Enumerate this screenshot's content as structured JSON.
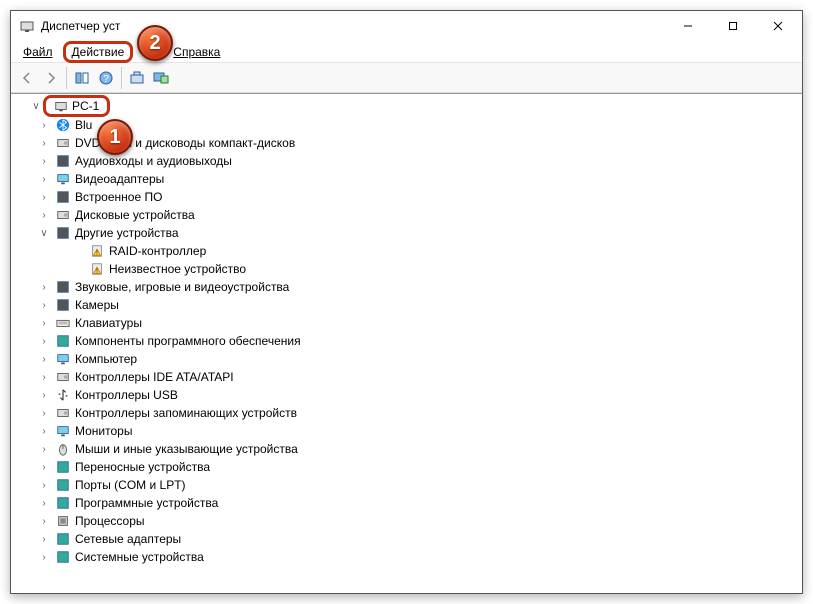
{
  "window": {
    "title": "Диспетчер уст"
  },
  "menu": {
    "file": "Файл",
    "action": "Действие",
    "help": "Справка"
  },
  "badges": {
    "step1": "1",
    "step2": "2"
  },
  "root": "PC-1",
  "categories": [
    {
      "icon": "bluetooth",
      "label": "Blu",
      "expandable": true
    },
    {
      "icon": "dvd",
      "label": "DVD                  воды и дисководы компакт-дисков",
      "expandable": true
    },
    {
      "icon": "audio",
      "label": "Аудиовходы и аудиовыходы",
      "expandable": true
    },
    {
      "icon": "display",
      "label": "Видеоадаптеры",
      "expandable": true
    },
    {
      "icon": "firmware",
      "label": "Встроенное ПО",
      "expandable": true
    },
    {
      "icon": "disk",
      "label": "Дисковые устройства",
      "expandable": true
    },
    {
      "icon": "other",
      "label": "Другие устройства",
      "expandable": true,
      "expanded": true,
      "children": [
        {
          "icon": "warn",
          "label": "RAID-контроллер"
        },
        {
          "icon": "warn",
          "label": "Неизвестное устройство"
        }
      ]
    },
    {
      "icon": "sound",
      "label": "Звуковые, игровые и видеоустройства",
      "expandable": true
    },
    {
      "icon": "camera",
      "label": "Камеры",
      "expandable": true
    },
    {
      "icon": "keyboard",
      "label": "Клавиатуры",
      "expandable": true
    },
    {
      "icon": "swcomp",
      "label": "Компоненты программного обеспечения",
      "expandable": true
    },
    {
      "icon": "computer",
      "label": "Компьютер",
      "expandable": true
    },
    {
      "icon": "ide",
      "label": "Контроллеры IDE ATA/ATAPI",
      "expandable": true
    },
    {
      "icon": "usb",
      "label": "Контроллеры USB",
      "expandable": true
    },
    {
      "icon": "storage",
      "label": "Контроллеры запоминающих устройств",
      "expandable": true
    },
    {
      "icon": "monitor",
      "label": "Мониторы",
      "expandable": true
    },
    {
      "icon": "mouse",
      "label": "Мыши и иные указывающие устройства",
      "expandable": true
    },
    {
      "icon": "portable",
      "label": "Переносные устройства",
      "expandable": true
    },
    {
      "icon": "ports",
      "label": "Порты (COM и LPT)",
      "expandable": true
    },
    {
      "icon": "softdev",
      "label": "Программные устройства",
      "expandable": true
    },
    {
      "icon": "cpu",
      "label": "Процессоры",
      "expandable": true
    },
    {
      "icon": "net",
      "label": "Сетевые адаптеры",
      "expandable": true
    },
    {
      "icon": "system",
      "label": "Системные устройства",
      "expandable": true
    }
  ]
}
